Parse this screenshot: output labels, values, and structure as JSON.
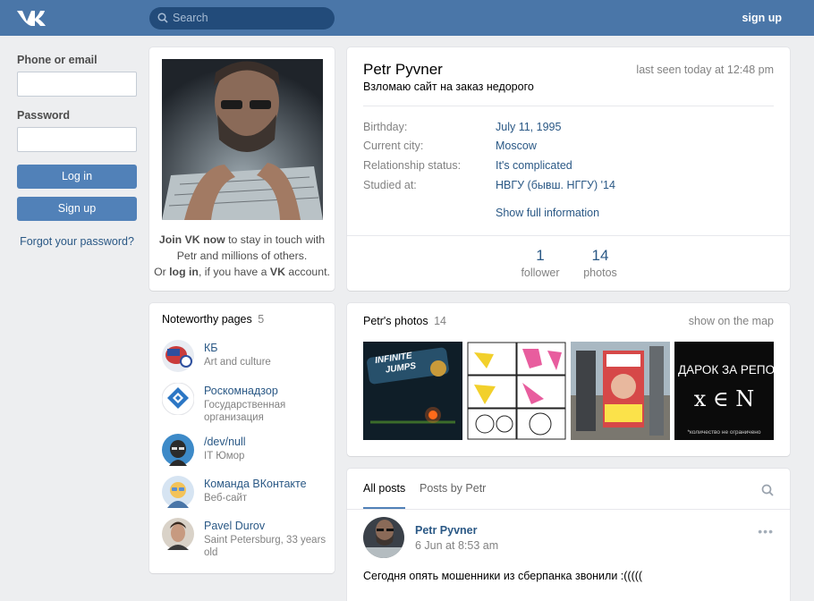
{
  "header": {
    "search_placeholder": "Search",
    "signup_label": "sign up"
  },
  "login": {
    "phone_label": "Phone or email",
    "password_label": "Password",
    "login_button": "Log in",
    "signup_button": "Sign up",
    "forgot_link": "Forgot your password?"
  },
  "join": {
    "line1_bold": "Join VK now",
    "line1_rest": " to stay in touch with",
    "line2": "Petr and millions of others.",
    "line3_pre": "Or ",
    "line3_link": "log in",
    "line3_mid": ", if you have a ",
    "line3_bold": "VK",
    "line3_post": " account."
  },
  "noteworthy": {
    "title": "Noteworthy pages",
    "count": "5",
    "items": [
      {
        "name": "КБ",
        "sub": "Art and culture",
        "sub2": ""
      },
      {
        "name": "Роскомнадзор",
        "sub": "Государственная",
        "sub2": "организация"
      },
      {
        "name": "/dev/null",
        "sub": "IT Юмор",
        "sub2": ""
      },
      {
        "name": "Команда ВКонтакте",
        "sub": "Веб-сайт",
        "sub2": ""
      },
      {
        "name": "Pavel Durov",
        "sub": "Saint Petersburg, 33 years",
        "sub2": "old"
      }
    ]
  },
  "profile": {
    "name": "Petr Pyvner",
    "status": "Взломаю сайт на заказ недорого",
    "last_seen": "last seen today at 12:48 pm",
    "fields": [
      {
        "label": "Birthday:",
        "value": "July 11, 1995"
      },
      {
        "label": "Current city:",
        "value": "Moscow"
      },
      {
        "label": "Relationship status:",
        "value": "It's complicated"
      },
      {
        "label": "Studied at:",
        "value": "НВГУ (бывш. НГГУ) '14"
      }
    ],
    "show_full": "Show full information",
    "counters": [
      {
        "num": "1",
        "label": "follower"
      },
      {
        "num": "14",
        "label": "photos"
      }
    ]
  },
  "photos": {
    "title": "Petr's photos",
    "count": "14",
    "map_link": "show on the map",
    "photo1": {
      "line1": "INFINITE",
      "line2": "JUMPS"
    },
    "photo4": {
      "line1": "ДАРОК ЗА РЕПО",
      "formula": "x ∈ N",
      "foot": "*количество не ограничено"
    }
  },
  "posts": {
    "tabs": [
      "All posts",
      "Posts by Petr"
    ],
    "post": {
      "author": "Petr Pyvner",
      "date": "6 Jun at 8:53 am",
      "text": "Сегодня опять мошенники из сберпанка звонили :((((("
    }
  },
  "colors": {
    "header": "#4a76a8",
    "button": "#5181b8",
    "link": "#2a5885"
  }
}
